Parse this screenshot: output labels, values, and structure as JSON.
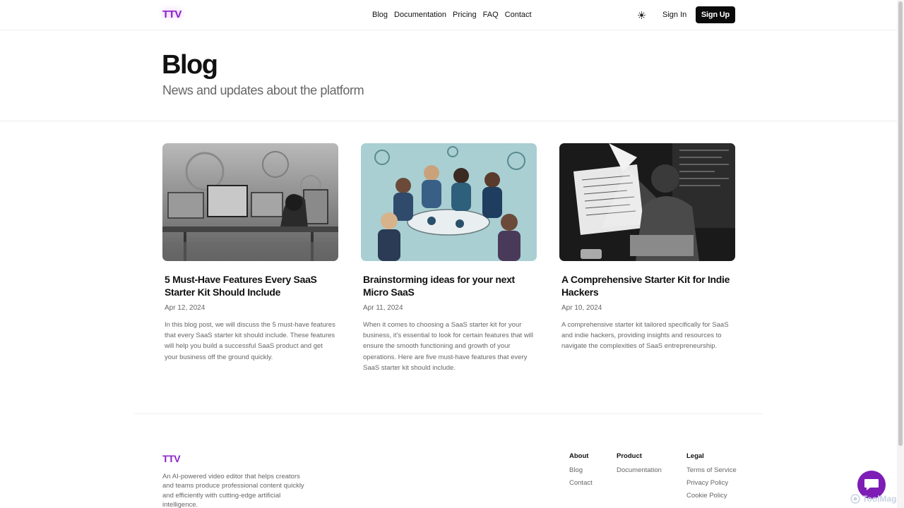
{
  "header": {
    "logo": "TTV",
    "nav": [
      "Blog",
      "Documentation",
      "Pricing",
      "FAQ",
      "Contact"
    ],
    "theme_icon": "sun-icon",
    "signin_label": "Sign In",
    "signup_label": "Sign Up"
  },
  "hero": {
    "title": "Blog",
    "subtitle": "News and updates about the platform"
  },
  "posts": [
    {
      "title": "5 Must-Have Features Every SaaS Starter Kit Should Include",
      "date": "Apr 12, 2024",
      "excerpt": "In this blog post, we will discuss the 5 must-have features that every SaaS starter kit should include. These features will help you build a successful SaaS product and get your business off the ground quickly.",
      "image": "grayscale sketch of a person working at multiple computer screens"
    },
    {
      "title": "Brainstorming ideas for your next Micro SaaS",
      "date": "Apr 11, 2024",
      "excerpt": "When it comes to choosing a SaaS starter kit for your business, it's essential to look for certain features that will ensure the smooth functioning and growth of your operations. Here are five must-have features that every SaaS starter kit should include.",
      "image": "illustration of a group of people brainstorming around a table"
    },
    {
      "title": "A Comprehensive Starter Kit for Indie Hackers",
      "date": "Apr 10, 2024",
      "excerpt": "A comprehensive starter kit tailored specifically for SaaS and indie hackers, providing insights and resources to navigate the complexities of SaaS entrepreneurship.",
      "image": "black and white illustration of a developer coding under a lamp"
    }
  ],
  "footer": {
    "logo": "TTV",
    "description": "An AI-powered video editor that helps creators and teams produce professional content quickly and efficiently with cutting-edge artificial intelligence.",
    "columns": [
      {
        "heading": "About",
        "links": [
          "Blog",
          "Contact"
        ]
      },
      {
        "heading": "Product",
        "links": [
          "Documentation"
        ]
      },
      {
        "heading": "Legal",
        "links": [
          "Terms of Service",
          "Privacy Policy",
          "Cookie Policy"
        ]
      }
    ]
  },
  "chat": {
    "icon": "chat-bubble-icon"
  },
  "watermark": "ToolMage",
  "colors": {
    "brand": "#8b22c9",
    "chat": "#7d1db5",
    "button": "#0b0b0b"
  }
}
